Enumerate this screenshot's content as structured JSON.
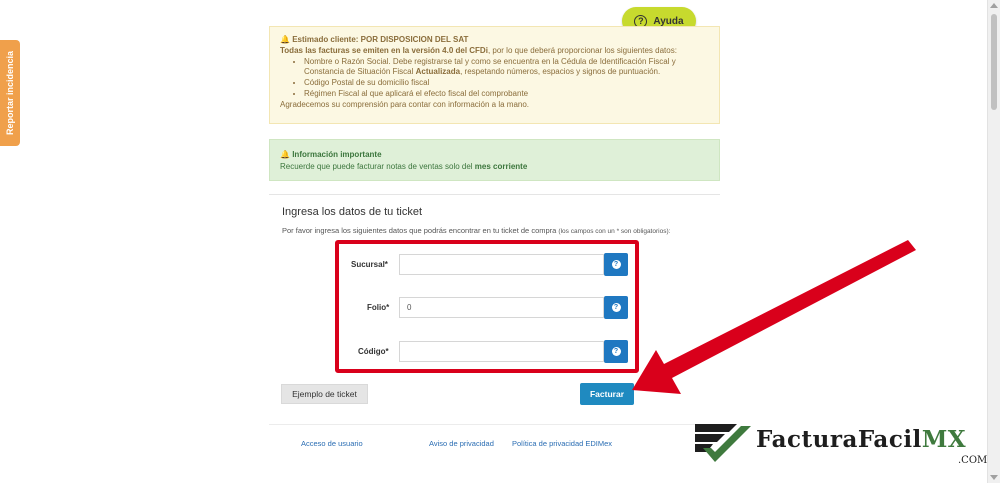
{
  "side_tab": {
    "label": "Reportar incidencia"
  },
  "help": {
    "icon": "question-circle-icon",
    "label": "Ayuda"
  },
  "alert_warning": {
    "icon": "bell-icon",
    "title": "Estimado cliente: POR DISPOSICION DEL SAT",
    "intro_bold": "Todas las facturas se emiten en la versión 4.0 del CFDi",
    "intro_rest": ", por lo que deberá proporcionar los siguientes datos:",
    "item1_start": "Nombre o Razón Social. Debe registrarse tal y como se encuentra en la Cédula de Identificación Fiscal y Constancia de Situación Fiscal ",
    "item1_bold": "Actualizada",
    "item1_end": ", respetando números, espacios y signos de puntuación.",
    "item2": "Código Postal de su domicilio fiscal",
    "item3": "Régimen Fiscal al que aplicará el efecto fiscal del comprobante",
    "closing": "Agradecemos su comprensión para contar con información a la mano."
  },
  "alert_info": {
    "icon": "bell-icon",
    "title": "Información importante",
    "text_start": "Recuerde que puede facturar notas de ventas solo del ",
    "text_bold": "mes corriente"
  },
  "form": {
    "title": "Ingresa los datos de tu ticket",
    "description": "Por favor ingresa los siguientes datos que podrás encontrar en tu ticket de compra",
    "note": "(los campos con un * son obligatorios):",
    "fields": [
      {
        "label": "Sucursal*",
        "value": "",
        "info_icon": "question-icon"
      },
      {
        "label": "Folio*",
        "value": "0",
        "info_icon": "question-icon"
      },
      {
        "label": "Código*",
        "value": "",
        "info_icon": "question-icon"
      }
    ],
    "example_button": "Ejemplo de ticket",
    "submit_button": "Facturar"
  },
  "footer": {
    "links": [
      "Acceso de usuario",
      "Aviso de privacidad",
      "Política de privacidad EDIMex"
    ]
  },
  "brand": {
    "name_main": "FacturaFacil",
    "name_accent": "MX",
    "domain": ".COM"
  },
  "colors": {
    "highlight_red": "#d9001b",
    "primary_blue": "#1f8ac0",
    "help_green": "#c7da2e",
    "side_tab_orange": "#f0a04b"
  }
}
